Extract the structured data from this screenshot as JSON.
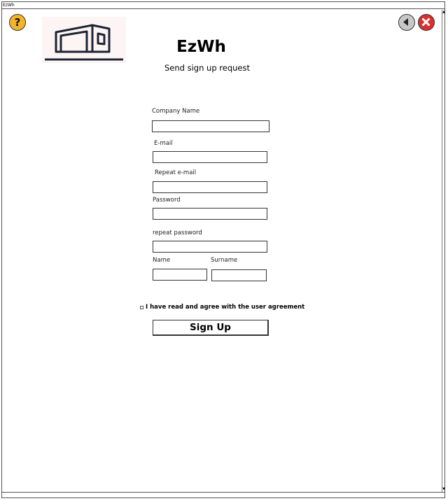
{
  "window": {
    "title": "EzWh"
  },
  "header": {
    "app_title": "EzWh",
    "subtitle": "Send sign up request",
    "help_icon": "question-icon",
    "back_icon": "back-arrow-icon",
    "close_icon": "close-icon",
    "logo_icon": "warehouse-icon"
  },
  "form": {
    "company_name_label": "Company Name",
    "email_label": "E-mail",
    "repeat_email_label": "Repeat e-mail",
    "password_label": "Password",
    "repeat_password_label": "repeat password",
    "name_label": "Name",
    "surname_label": "Surname",
    "company_name_value": "",
    "email_value": "",
    "repeat_email_value": "",
    "password_value": "",
    "repeat_password_value": "",
    "name_value": "",
    "surname_value": "",
    "agreement_label": "I have read and agree with the user agreement",
    "agreement_checked": false,
    "submit_label": "Sign Up"
  },
  "colors": {
    "help_button": "#f3b42b",
    "close_button": "#d63232",
    "back_button": "#c8c8c8",
    "logo_background": "#fdf4f4"
  }
}
